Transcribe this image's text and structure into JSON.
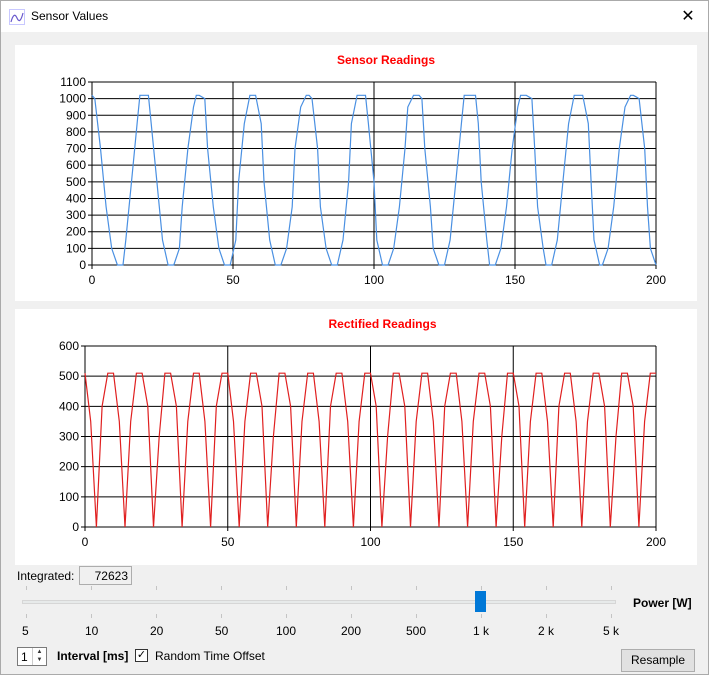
{
  "window": {
    "title": "Sensor Values",
    "close_glyph": "✕"
  },
  "chart_data": [
    {
      "type": "line",
      "title": "Sensor Readings",
      "title_color": "#ff0000",
      "series_color": "#4a90e2",
      "xlim": [
        0,
        200
      ],
      "ylim": [
        0,
        1100
      ],
      "xticks": [
        "0",
        "50",
        "100",
        "150",
        "200"
      ],
      "yticks": [
        "0",
        "100",
        "200",
        "300",
        "400",
        "500",
        "600",
        "700",
        "800",
        "900",
        "1000",
        "1100"
      ],
      "x": [
        0,
        1,
        3,
        5,
        7,
        9,
        11,
        12,
        14,
        16,
        17,
        18,
        20,
        21,
        23,
        25,
        27,
        29,
        31,
        32,
        34,
        36,
        37,
        38,
        40,
        41,
        43,
        45,
        47,
        49,
        51,
        52,
        54,
        56,
        57,
        58,
        60,
        61,
        63,
        65,
        67,
        69,
        71,
        72,
        74,
        76,
        77,
        78,
        80,
        81,
        83,
        85,
        87,
        89,
        91,
        92,
        94,
        96,
        97,
        98,
        100,
        101,
        103,
        105,
        107,
        109,
        111,
        112,
        114,
        116,
        117,
        118,
        120,
        121,
        123,
        125,
        127,
        129,
        131,
        132,
        134,
        136,
        137,
        138,
        140,
        141,
        143,
        145,
        147,
        149,
        151,
        152,
        154,
        156,
        157,
        158,
        160,
        161,
        163,
        165,
        167,
        169,
        171,
        172,
        174,
        176,
        177,
        178,
        180,
        181,
        183,
        185,
        187,
        189,
        191,
        192,
        194,
        196,
        197,
        198,
        200
      ],
      "y": [
        1020,
        1000,
        700,
        350,
        100,
        0,
        0,
        150,
        500,
        850,
        1020,
        1020,
        1020,
        850,
        500,
        150,
        0,
        0,
        100,
        350,
        700,
        950,
        1020,
        1020,
        1000,
        700,
        350,
        100,
        0,
        0,
        150,
        500,
        850,
        1020,
        1020,
        1020,
        850,
        500,
        150,
        0,
        0,
        100,
        350,
        700,
        950,
        1020,
        1020,
        1000,
        700,
        350,
        100,
        0,
        0,
        150,
        500,
        850,
        1020,
        1020,
        1020,
        850,
        500,
        150,
        0,
        0,
        100,
        350,
        700,
        950,
        1020,
        1020,
        1000,
        700,
        350,
        100,
        0,
        0,
        150,
        500,
        850,
        1020,
        1020,
        1020,
        850,
        500,
        150,
        0,
        0,
        100,
        350,
        700,
        950,
        1020,
        1020,
        1000,
        700,
        350,
        100,
        0,
        0,
        150,
        500,
        850,
        1020,
        1020,
        1020,
        850,
        500,
        150,
        0,
        0,
        100,
        350,
        700,
        950,
        1020,
        1020,
        1000,
        700,
        350,
        100,
        0
      ]
    },
    {
      "type": "line",
      "title": "Rectified Readings",
      "title_color": "#ff0000",
      "series_color": "#e02020",
      "xlim": [
        0,
        200
      ],
      "ylim": [
        0,
        600
      ],
      "xticks": [
        "0",
        "50",
        "100",
        "150",
        "200"
      ],
      "yticks": [
        "0",
        "100",
        "200",
        "300",
        "400",
        "500",
        "600"
      ],
      "x": [
        0,
        2,
        4,
        6,
        8,
        10,
        12,
        14,
        16,
        18,
        20,
        22,
        24,
        26,
        28,
        30,
        32,
        34,
        36,
        38,
        40,
        42,
        44,
        46,
        48,
        50,
        52,
        54,
        56,
        58,
        60,
        62,
        64,
        66,
        68,
        70,
        72,
        74,
        76,
        78,
        80,
        82,
        84,
        86,
        88,
        90,
        92,
        94,
        96,
        98,
        100,
        102,
        104,
        106,
        108,
        110,
        112,
        114,
        116,
        118,
        120,
        122,
        124,
        126,
        128,
        130,
        132,
        134,
        136,
        138,
        140,
        142,
        144,
        146,
        148,
        150,
        152,
        154,
        156,
        158,
        160,
        162,
        164,
        166,
        168,
        170,
        172,
        174,
        176,
        178,
        180,
        182,
        184,
        186,
        188,
        190,
        192,
        194,
        196,
        198,
        200
      ],
      "y": [
        510,
        350,
        0,
        400,
        510,
        510,
        350,
        0,
        350,
        510,
        510,
        400,
        0,
        300,
        510,
        510,
        400,
        0,
        350,
        510,
        510,
        350,
        0,
        400,
        510,
        510,
        350,
        0,
        350,
        510,
        510,
        400,
        0,
        300,
        510,
        510,
        400,
        0,
        350,
        510,
        510,
        350,
        0,
        400,
        510,
        510,
        350,
        0,
        350,
        510,
        510,
        400,
        0,
        300,
        510,
        510,
        400,
        0,
        350,
        510,
        510,
        350,
        0,
        400,
        510,
        510,
        350,
        0,
        350,
        510,
        510,
        400,
        0,
        300,
        510,
        510,
        400,
        0,
        350,
        510,
        510,
        350,
        0,
        400,
        510,
        510,
        350,
        0,
        350,
        510,
        510,
        400,
        0,
        300,
        510,
        510,
        400,
        0,
        350,
        510,
        510
      ]
    }
  ],
  "integrated": {
    "label": "Integrated:",
    "value": "72623"
  },
  "power": {
    "label": "Power [W]",
    "scale": [
      "5",
      "10",
      "20",
      "50",
      "100",
      "200",
      "500",
      "1 k",
      "2 k",
      "5 k"
    ],
    "selected": "1 k"
  },
  "interval": {
    "value": "1",
    "label": "Interval [ms]"
  },
  "random_offset": {
    "label": "Random Time Offset",
    "checked": true,
    "check_glyph": "✓"
  },
  "resample": {
    "label": "Resample"
  }
}
